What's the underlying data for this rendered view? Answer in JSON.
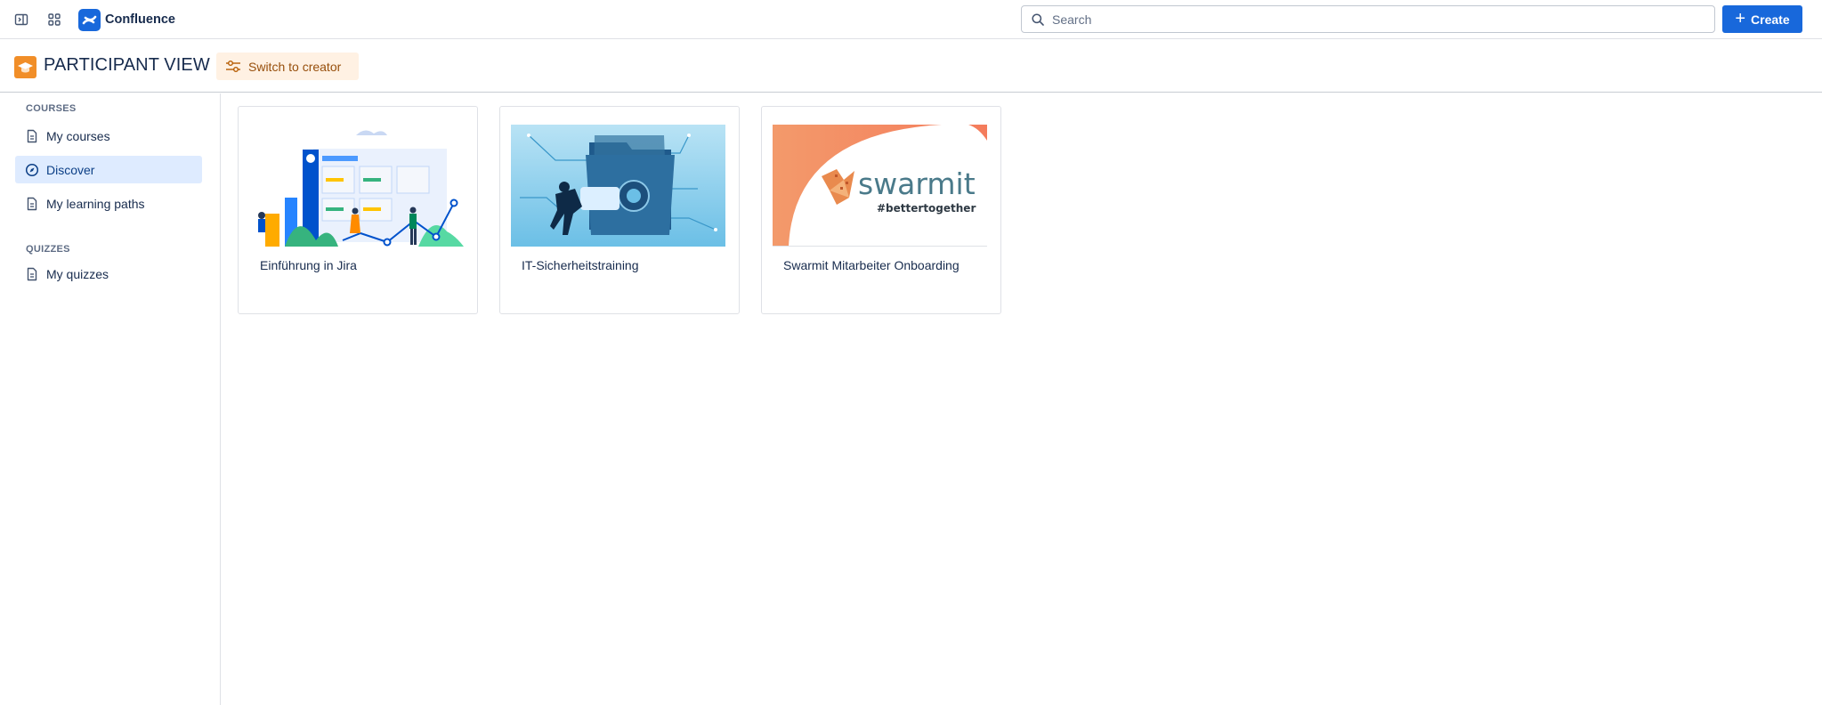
{
  "app": {
    "name": "Confluence",
    "brand_color": "#1868db"
  },
  "topnav": {
    "search_placeholder": "Search",
    "create_label": "Create",
    "icons": [
      "sidebar-toggle-icon",
      "app-switcher-icon",
      "search-icon",
      "plus-icon"
    ]
  },
  "subheader": {
    "title": "PARTICIPANT VIEW",
    "switch_label": "Switch to creator",
    "accent": "#f18e28"
  },
  "sidebar": {
    "sections": [
      {
        "label": "COURSES",
        "items": [
          {
            "label": "My courses",
            "icon": "document-icon",
            "active": false
          },
          {
            "label": "Discover",
            "icon": "compass-icon",
            "active": true
          },
          {
            "label": "My learning paths",
            "icon": "document-icon",
            "active": false
          }
        ]
      },
      {
        "label": "QUIZZES",
        "items": [
          {
            "label": "My quizzes",
            "icon": "document-icon",
            "active": false
          }
        ]
      }
    ]
  },
  "courses": [
    {
      "title": "Einführung in Jira",
      "image": "jira-illustration"
    },
    {
      "title": "IT-Sicherheitstraining",
      "image": "security-folder-illustration"
    },
    {
      "title": "Swarmit Mitarbeiter Onboarding",
      "image": "swarmit-logo",
      "logo_text": "swarmit",
      "tagline": "#bettertogether"
    }
  ]
}
